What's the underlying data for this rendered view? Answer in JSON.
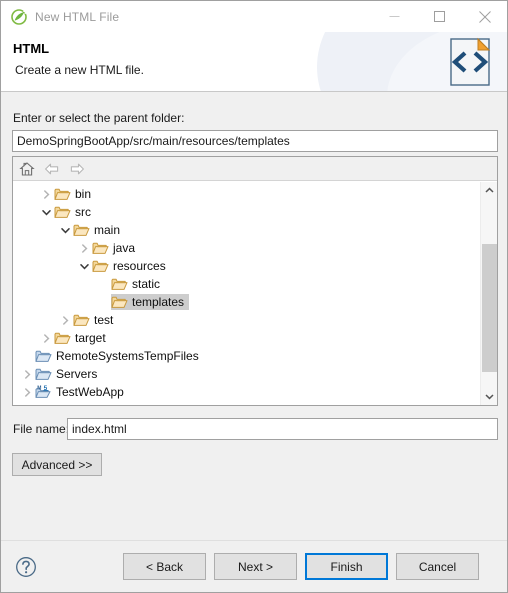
{
  "window": {
    "title": "New HTML File",
    "icon": "spring-leaf-icon",
    "controls": {
      "minimize": "minimize-icon",
      "maximize": "maximize-icon",
      "close": "close-icon"
    }
  },
  "header": {
    "title": "HTML",
    "description": "Create a new HTML file.",
    "icon": "html-document-icon"
  },
  "form": {
    "parent_folder_label": "Enter or select the parent folder:",
    "parent_folder_value": "DemoSpringBootApp/src/main/resources/templates",
    "filename_label": "File name:",
    "filename_value": "index.html",
    "advanced_label": "Advanced >>"
  },
  "tree_toolbar": {
    "home": "home-icon",
    "back": "back-arrow-icon",
    "forward": "forward-arrow-icon"
  },
  "tree": {
    "items": [
      {
        "label": "bin",
        "depth": 1,
        "state": "collapsed",
        "icon": "folder-icon",
        "selected": false
      },
      {
        "label": "src",
        "depth": 1,
        "state": "expanded",
        "icon": "folder-icon",
        "selected": false
      },
      {
        "label": "main",
        "depth": 2,
        "state": "expanded",
        "icon": "folder-icon",
        "selected": false
      },
      {
        "label": "java",
        "depth": 3,
        "state": "collapsed",
        "icon": "folder-icon",
        "selected": false
      },
      {
        "label": "resources",
        "depth": 3,
        "state": "expanded",
        "icon": "folder-icon",
        "selected": false
      },
      {
        "label": "static",
        "depth": 4,
        "state": "leaf",
        "icon": "folder-icon",
        "selected": false
      },
      {
        "label": "templates",
        "depth": 4,
        "state": "leaf",
        "icon": "folder-icon",
        "selected": true
      },
      {
        "label": "test",
        "depth": 2,
        "state": "collapsed",
        "icon": "folder-icon",
        "selected": false
      },
      {
        "label": "target",
        "depth": 1,
        "state": "collapsed",
        "icon": "folder-icon",
        "selected": false
      },
      {
        "label": "RemoteSystemsTempFiles",
        "depth": 0,
        "state": "leaf",
        "icon": "blue-folder-icon",
        "selected": false
      },
      {
        "label": "Servers",
        "depth": 0,
        "state": "collapsed",
        "icon": "blue-folder-icon",
        "selected": false
      },
      {
        "label": "TestWebApp",
        "depth": 0,
        "state": "collapsed",
        "icon": "maven-project-icon",
        "selected": false
      }
    ],
    "scrollbar": {
      "up": "scroll-up-icon",
      "down": "scroll-down-icon"
    }
  },
  "footer": {
    "help": "help-icon",
    "back_label": "< Back",
    "next_label": "Next >",
    "finish_label": "Finish",
    "cancel_label": "Cancel"
  },
  "colors": {
    "accent": "#0078D7",
    "dialog_bg": "#F0F0F0",
    "selection": "#CDCDCD",
    "folder": "#E8A33D",
    "title_text": "#9B9B9B"
  }
}
